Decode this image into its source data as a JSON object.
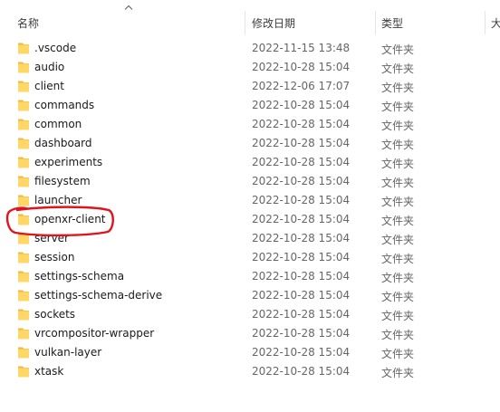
{
  "columns": {
    "name": "名称",
    "modified": "修改日期",
    "type": "类型",
    "size_partial": "大"
  },
  "files": [
    {
      "name": ".vscode",
      "date": "2022-11-15 13:48",
      "type": "文件夹"
    },
    {
      "name": "audio",
      "date": "2022-10-28 15:04",
      "type": "文件夹"
    },
    {
      "name": "client",
      "date": "2022-12-06 17:07",
      "type": "文件夹"
    },
    {
      "name": "commands",
      "date": "2022-10-28 15:04",
      "type": "文件夹"
    },
    {
      "name": "common",
      "date": "2022-10-28 15:04",
      "type": "文件夹"
    },
    {
      "name": "dashboard",
      "date": "2022-10-28 15:04",
      "type": "文件夹"
    },
    {
      "name": "experiments",
      "date": "2022-10-28 15:04",
      "type": "文件夹"
    },
    {
      "name": "filesystem",
      "date": "2022-10-28 15:04",
      "type": "文件夹"
    },
    {
      "name": "launcher",
      "date": "2022-10-28 15:04",
      "type": "文件夹"
    },
    {
      "name": "openxr-client",
      "date": "2022-10-28 15:04",
      "type": "文件夹"
    },
    {
      "name": "server",
      "date": "2022-10-28 15:04",
      "type": "文件夹"
    },
    {
      "name": "session",
      "date": "2022-10-28 15:04",
      "type": "文件夹"
    },
    {
      "name": "settings-schema",
      "date": "2022-10-28 15:04",
      "type": "文件夹"
    },
    {
      "name": "settings-schema-derive",
      "date": "2022-10-28 15:04",
      "type": "文件夹"
    },
    {
      "name": "sockets",
      "date": "2022-10-28 15:04",
      "type": "文件夹"
    },
    {
      "name": "vrcompositor-wrapper",
      "date": "2022-10-28 15:04",
      "type": "文件夹"
    },
    {
      "name": "vulkan-layer",
      "date": "2022-10-28 15:04",
      "type": "文件夹"
    },
    {
      "name": "xtask",
      "date": "2022-10-28 15:04",
      "type": "文件夹"
    }
  ],
  "annotation": {
    "color": "#e0141b",
    "target": "openxr-client"
  },
  "icons": {
    "folder": "folder-icon",
    "sort": "sort-ascending-icon"
  },
  "colors": {
    "folder_front": "#ffd766",
    "folder_back": "#f0b93c"
  }
}
